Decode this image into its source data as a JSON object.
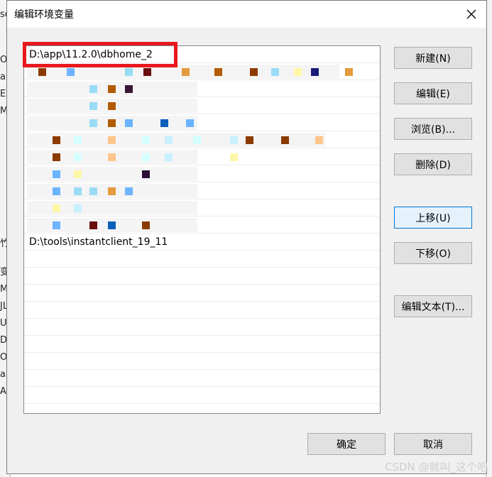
{
  "dialog": {
    "title": "编辑环境变量",
    "close_glyph": "✕"
  },
  "list": {
    "items": [
      "D:\\app\\11.2.0\\dbhome_2",
      "",
      "",
      "",
      "",
      "",
      "",
      "",
      "",
      "",
      "",
      "D:\\tools\\instantclient_19_11",
      "",
      "",
      "",
      "",
      "",
      "",
      "",
      "",
      "",
      ""
    ]
  },
  "buttons": {
    "new": "新建(N)",
    "edit": "编辑(E)",
    "browse": "浏览(B)...",
    "delete": "删除(D)",
    "move_up": "上移(U)",
    "move_down": "下移(O)",
    "edit_text": "编辑文本(T)...",
    "ok": "确定",
    "cancel": "取消"
  },
  "background": {
    "fragments": [
      "so",
      "Or",
      "a",
      "E",
      "M",
      "",
      "",
      "",
      "",
      "",
      "",
      "",
      "",
      "",
      "",
      "竹",
      "变",
      "M",
      "JL",
      "U",
      "DF",
      "OS",
      "a",
      "A"
    ]
  },
  "watermark": "CSDN @就叫_这个吧",
  "colors": {
    "highlight": "#e8181d",
    "focus": "#0078d7"
  }
}
